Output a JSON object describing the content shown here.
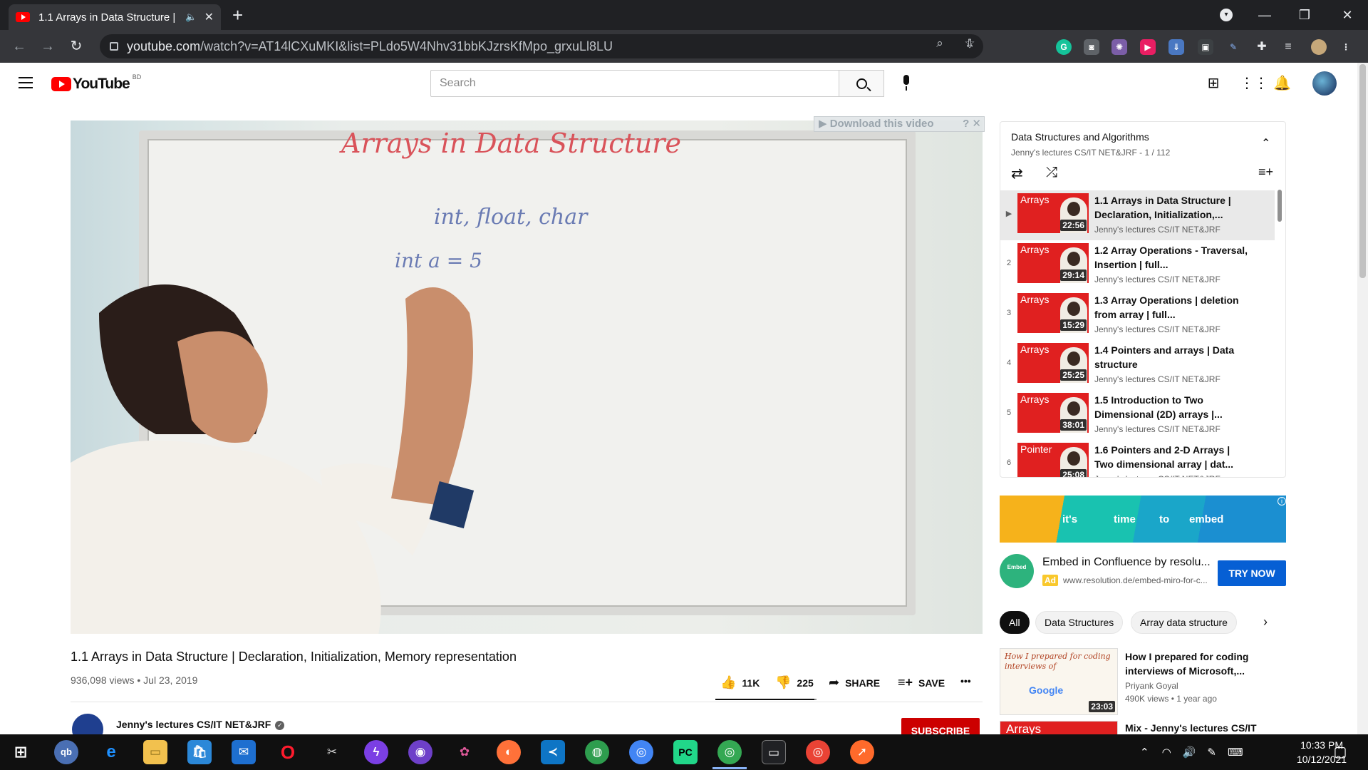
{
  "browser": {
    "tab_title": "1.1 Arrays in Data Structure |",
    "tab_mute_icon": "speaker-icon",
    "url_host": "youtube.com",
    "url_path": "/watch?v=AT14lCXuMKI&list=PLdo5W4Nhv31bbKJzrsKfMpo_grxuLl8LU"
  },
  "youtube": {
    "logo_word": "YouTube",
    "country_code": "BD",
    "search_placeholder": "Search"
  },
  "player": {
    "board_title": "Arrays in Data Structure",
    "board_line1": "int, float, char",
    "board_line2": "int a = 5",
    "download_bar": "Download this video"
  },
  "video": {
    "title": "1.1 Arrays in Data Structure | Declaration, Initialization, Memory representation",
    "views_date": "936,098 views • Jul 23, 2019",
    "likes": "11K",
    "dislikes": "225",
    "like_ratio": 0.98,
    "share": "SHARE",
    "save": "SAVE",
    "more": "•••",
    "channel": "Jenny's lectures CS/IT NET&JRF",
    "subscribe": "SUBSCRIBE"
  },
  "playlist": {
    "title": "Data Structures and Algorithms",
    "subtitle": "Jenny's lectures CS/IT NET&JRF - 1 / 112",
    "items": [
      {
        "index": "▶",
        "title": "1.1 Arrays in Data Structure | Declaration, Initialization,...",
        "channel": "Jenny's lectures CS/IT NET&JRF",
        "duration": "22:56",
        "label": "Arrays"
      },
      {
        "index": "2",
        "title": "1.2 Array Operations - Traversal, Insertion | full...",
        "channel": "Jenny's lectures CS/IT NET&JRF",
        "duration": "29:14",
        "label": "Arrays"
      },
      {
        "index": "3",
        "title": "1.3 Array Operations | deletion from array | full...",
        "channel": "Jenny's lectures CS/IT NET&JRF",
        "duration": "15:29",
        "label": "Arrays"
      },
      {
        "index": "4",
        "title": "1.4 Pointers and arrays | Data structure",
        "channel": "Jenny's lectures CS/IT NET&JRF",
        "duration": "25:25",
        "label": "Arrays"
      },
      {
        "index": "5",
        "title": "1.5 Introduction to Two Dimensional (2D) arrays |...",
        "channel": "Jenny's lectures CS/IT NET&JRF",
        "duration": "38:01",
        "label": "Arrays"
      },
      {
        "index": "6",
        "title": "1.6 Pointers and 2-D Arrays | Two dimensional array | dat...",
        "channel": "Jenny's lectures CS/IT NET&JRF",
        "duration": "25:08",
        "label": "Pointer"
      }
    ]
  },
  "ad": {
    "words": [
      "it's",
      "time",
      "to",
      "embed"
    ],
    "logo_text": "Embed",
    "title": "Embed in Confluence by resolu...",
    "badge": "Ad",
    "url": "www.resolution.de/embed-miro-for-c...",
    "cta": "TRY NOW"
  },
  "chips": [
    "All",
    "Data Structures",
    "Array data structure"
  ],
  "recommendations": [
    {
      "title": "How I prepared for coding interviews of Microsoft,...",
      "channel": "Priyank Goyal",
      "meta": "490K views • 1 year ago",
      "duration": "23:03",
      "thumb_text": "How I prepared for coding interviews of"
    },
    {
      "title": "Mix - Jenny's lectures CS/IT",
      "channel": "",
      "meta": "",
      "duration": "",
      "thumb_text": "Arrays"
    }
  ],
  "taskbar": {
    "clock_time": "10:33 PM",
    "clock_date": "10/12/2021"
  },
  "colors": {
    "yt_red": "#ff0000",
    "subscribe_red": "#cc0000",
    "ad_blue": "#065fd4",
    "chrome_dark": "#202124"
  }
}
